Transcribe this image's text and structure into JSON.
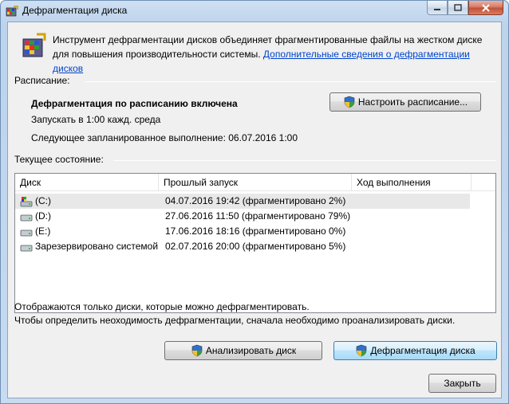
{
  "window": {
    "title": "Дефрагментация диска"
  },
  "intro": {
    "text": "Инструмент дефрагментации дисков объединяет фрагментированные файлы на жестком диске для повышения производительности системы. ",
    "link": "Дополнительные сведения о дефрагментации дисков"
  },
  "schedule": {
    "group_label": "Расписание:",
    "status": "Дефрагментация по расписанию включена",
    "run_at": "Запускать в 1:00 кажд. среда",
    "next_run": "Следующее запланированное выполнение: 06.07.2016 1:00",
    "configure_button": "Настроить расписание..."
  },
  "current": {
    "group_label": "Текущее состояние:"
  },
  "table": {
    "columns": [
      "Диск",
      "Прошлый запуск",
      "Ход выполнения"
    ],
    "rows": [
      {
        "disk": "(C:)",
        "last_run": "04.07.2016 19:42 (фрагментировано 2%)",
        "progress": "",
        "icon": "system-drive-icon",
        "selected": true
      },
      {
        "disk": "(D:)",
        "last_run": "27.06.2016 11:50 (фрагментировано 79%)",
        "progress": "",
        "icon": "hard-drive-icon",
        "selected": false
      },
      {
        "disk": "(E:)",
        "last_run": "17.06.2016 18:16 (фрагментировано 0%)",
        "progress": "",
        "icon": "hard-drive-icon",
        "selected": false
      },
      {
        "disk": "Зарезервировано системой",
        "last_run": "02.07.2016 20:00 (фрагментировано 5%)",
        "progress": "",
        "icon": "hard-drive-icon",
        "selected": false
      }
    ]
  },
  "notes": {
    "line1": "Отображаются только диски, которые можно дефрагментировать.",
    "line2": "Чтобы определить неоходимость  дефрагментации, сначала необходимо проанализировать диски."
  },
  "buttons": {
    "analyze": "Анализировать диск",
    "defragment": "Дефрагментация диска",
    "close": "Закрыть"
  },
  "colors": {
    "link": "#0044cc",
    "titlebar": "#bcd3ec",
    "default_button": "#bee6fd"
  }
}
